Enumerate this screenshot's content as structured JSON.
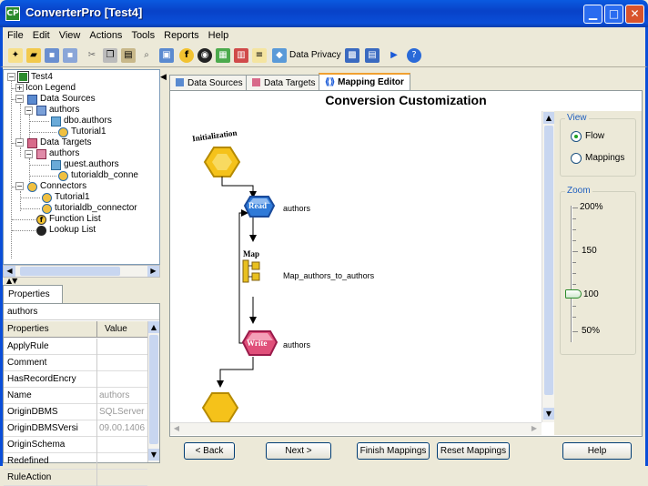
{
  "window": {
    "title": "ConverterPro [Test4]",
    "app_icon_text": "CP"
  },
  "menu": [
    "File",
    "Edit",
    "View",
    "Actions",
    "Tools",
    "Reports",
    "Help"
  ],
  "toolbar": {
    "data_privacy_label": "Data Privacy"
  },
  "tree": {
    "root": "Test4",
    "icon_legend": "Icon Legend",
    "data_sources": "Data Sources",
    "ds_authors": "authors",
    "ds_dbo_authors": "dbo.authors",
    "ds_tutorial1": "Tutorial1",
    "data_targets": "Data Targets",
    "dt_authors": "authors",
    "dt_guest_authors": "guest.authors",
    "dt_tutorialdb": "tutorialdb_conne",
    "connectors": "Connectors",
    "conn_tutorial1": "Tutorial1",
    "conn_tutorialdb": "tutorialdb_connector",
    "function_list": "Function List",
    "lookup_list": "Lookup List"
  },
  "properties": {
    "tab_label": "Properties",
    "object_name": "authors",
    "col_properties": "Properties",
    "col_value": "Value",
    "rows": [
      {
        "name": "ApplyRule",
        "value": ""
      },
      {
        "name": "Comment",
        "value": ""
      },
      {
        "name": "HasRecordEncry",
        "value": ""
      },
      {
        "name": "Name",
        "value": "authors"
      },
      {
        "name": "OriginDBMS",
        "value": "SQLServer"
      },
      {
        "name": "OriginDBMSVersi",
        "value": "09.00.1406"
      },
      {
        "name": "OriginSchema",
        "value": ""
      },
      {
        "name": "Redefined",
        "value": ""
      },
      {
        "name": "RuleAction",
        "value": ""
      }
    ]
  },
  "tabs": [
    {
      "label": "Data Sources"
    },
    {
      "label": "Data Targets"
    },
    {
      "label": "Mapping Editor"
    }
  ],
  "editor": {
    "title": "Conversion Customization",
    "init_label": "Initialization",
    "read_label": "Read",
    "read_target": "authors",
    "map_label": "Map",
    "map_target": "Map_authors_to_authors",
    "write_label": "Write",
    "write_target": "authors"
  },
  "view_panel": {
    "group_label": "View",
    "flow_label": "Flow",
    "mappings_label": "Mappings",
    "selected": "Flow"
  },
  "zoom": {
    "group_label": "Zoom",
    "labels": [
      "200%",
      "150",
      "100",
      "50%"
    ],
    "current": "100"
  },
  "buttons": {
    "back": "< Back",
    "next": "Next >",
    "finish": "Finish Mappings",
    "reset": "Reset Mappings",
    "help": "Help"
  },
  "colors": {
    "titlebar": "#0a4ed8",
    "accent": "#f0a030",
    "init_node": "#f5c21a",
    "read_node": "#2f7ad8",
    "write_node": "#e0507a"
  }
}
